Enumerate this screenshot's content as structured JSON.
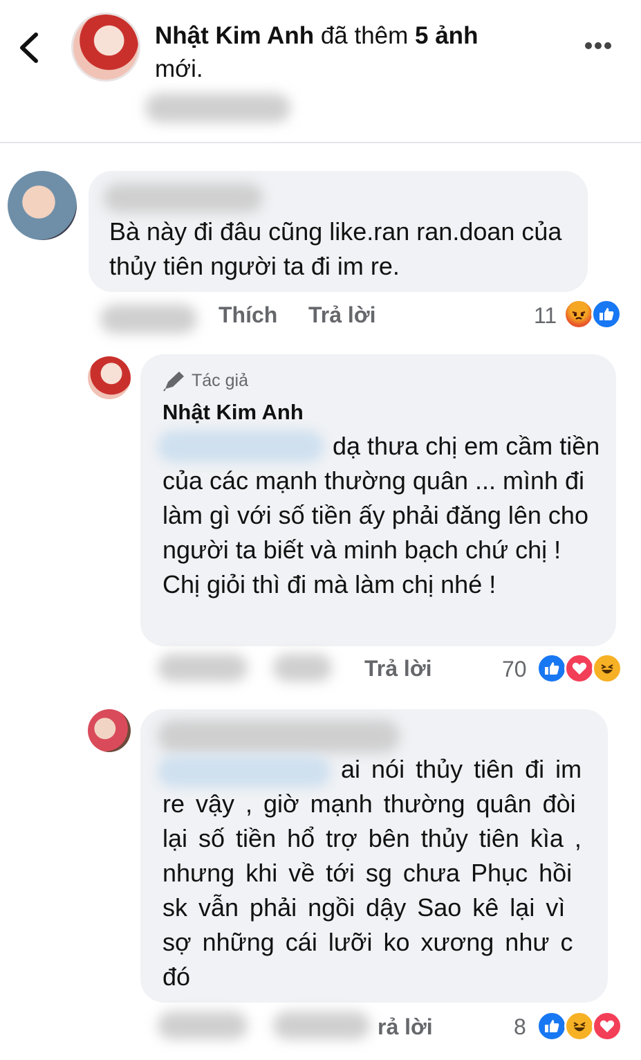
{
  "header": {
    "author": "Nhật Kim Anh",
    "added_text": "đã thêm",
    "photo_count": "5 ảnh",
    "new_text": "mới."
  },
  "comments": [
    {
      "text": "Bà này đi đâu cũng like.ran ran.doan của thủy tiên người ta đi im re.",
      "like_label": "Thích",
      "reply_label": "Trả lời",
      "reaction_count": "11",
      "reactions": [
        "angry-icon",
        "like-icon"
      ]
    },
    {
      "badge": "Tác giả",
      "author": "Nhật Kim Anh",
      "text": "dạ thưa chị em cầm tiền của các mạnh thường quân ... mình đi làm gì với số tiền ấy phải đăng lên cho người ta biết và minh bạch chứ chị ! Chị giỏi thì đi mà làm chị nhé !",
      "reply_label": "Trả lời",
      "reaction_count": "70",
      "reactions": [
        "like-icon",
        "love-icon",
        "haha-icon"
      ]
    },
    {
      "text": "ai nói thủy tiên đi im re vậy , giờ mạnh thường quân đòi lại số tiền hổ trợ bên thủy tiên kìa , nhưng khi về tới sg chưa Phục hồi sk vẫn phải ngồi dậy Sao kê lại vì sợ những cái lưỡi ko xương như c đó",
      "reply_label": "rả lời",
      "reaction_count": "8",
      "reactions": [
        "like-icon",
        "haha-icon",
        "love-icon"
      ]
    }
  ],
  "colors": {
    "bubble": "#f0f2f5",
    "secondary_text": "#65676b",
    "like": "#1877f2",
    "love": "#f33e58",
    "haha": "#f7b125",
    "angry": "#e8552a"
  }
}
